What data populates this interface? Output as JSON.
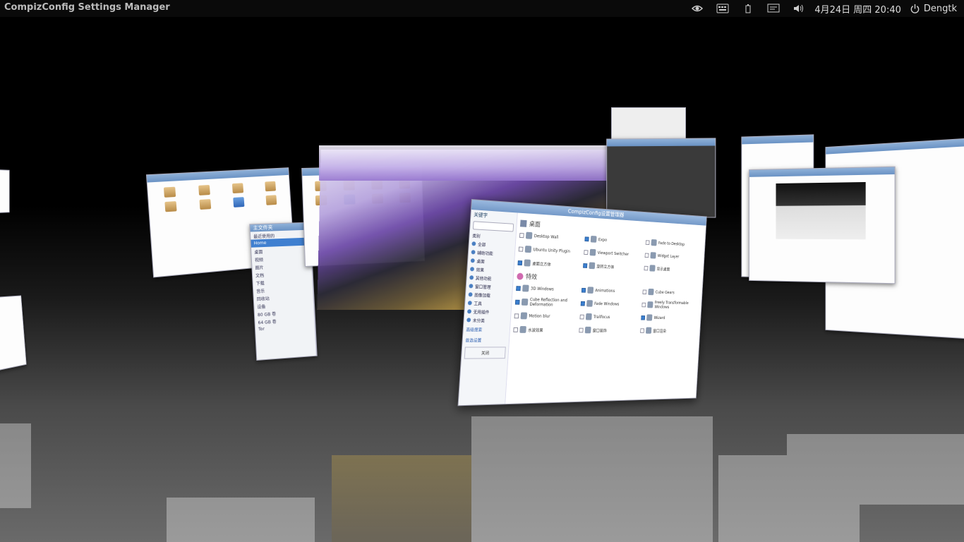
{
  "panel": {
    "app_title": "CompizConfig Settings Manager",
    "clock": "4月24日 周四 20:40",
    "user": "Dengtk",
    "indicators": [
      "nvidia-icon",
      "keyboard-icon",
      "battery-icon",
      "display-icon",
      "volume-icon"
    ]
  },
  "file_window": {
    "title": "主文件夹",
    "sidebar_items": [
      "最近使用的",
      "Home",
      "桌面",
      "视频",
      "图片",
      "文档",
      "下载",
      "音乐",
      "回收站",
      "设备",
      "80 GB 卷",
      "64 GB 卷",
      "Tor"
    ]
  },
  "ccsm": {
    "title": "CompizConfig设置管理器",
    "filter_label": "关键字",
    "categories": [
      "类别",
      "全部",
      "辅助功能",
      "桌面",
      "效果",
      "其他功能",
      "窗口管理",
      "图像加载",
      "工具",
      "无用插件",
      "未分类"
    ],
    "links": [
      "高级搜索",
      "首选设置"
    ],
    "back_button": "关闭",
    "desktop_section": "桌面",
    "effects_section": "特效",
    "desktop_plugins": [
      {
        "label": "Desktop Wall",
        "on": false
      },
      {
        "label": "Expo",
        "on": true
      },
      {
        "label": "Fade to Desktop",
        "on": false
      },
      {
        "label": "Ubuntu Unity Plugin",
        "on": false
      },
      {
        "label": "Viewport Switcher",
        "on": false
      },
      {
        "label": "Widget Layer",
        "on": false
      },
      {
        "label": "桌面立方体",
        "on": true
      },
      {
        "label": "旋转立方体",
        "on": true
      },
      {
        "label": "显示桌面",
        "on": false
      }
    ],
    "effects_plugins": [
      {
        "label": "3D Windows",
        "on": true
      },
      {
        "label": "Animations",
        "on": true
      },
      {
        "label": "Cube Gears",
        "on": false
      },
      {
        "label": "Cube Reflection and Deformation",
        "on": true
      },
      {
        "label": "Fade Windows",
        "on": true
      },
      {
        "label": "Freely Transformable Windows",
        "on": false
      },
      {
        "label": "Motion blur",
        "on": false
      },
      {
        "label": "Trailfocus",
        "on": false
      },
      {
        "label": "Wizard",
        "on": true
      },
      {
        "label": "水波效果",
        "on": false
      },
      {
        "label": "窗口装饰",
        "on": false
      },
      {
        "label": "窗口渲染",
        "on": false
      }
    ]
  }
}
